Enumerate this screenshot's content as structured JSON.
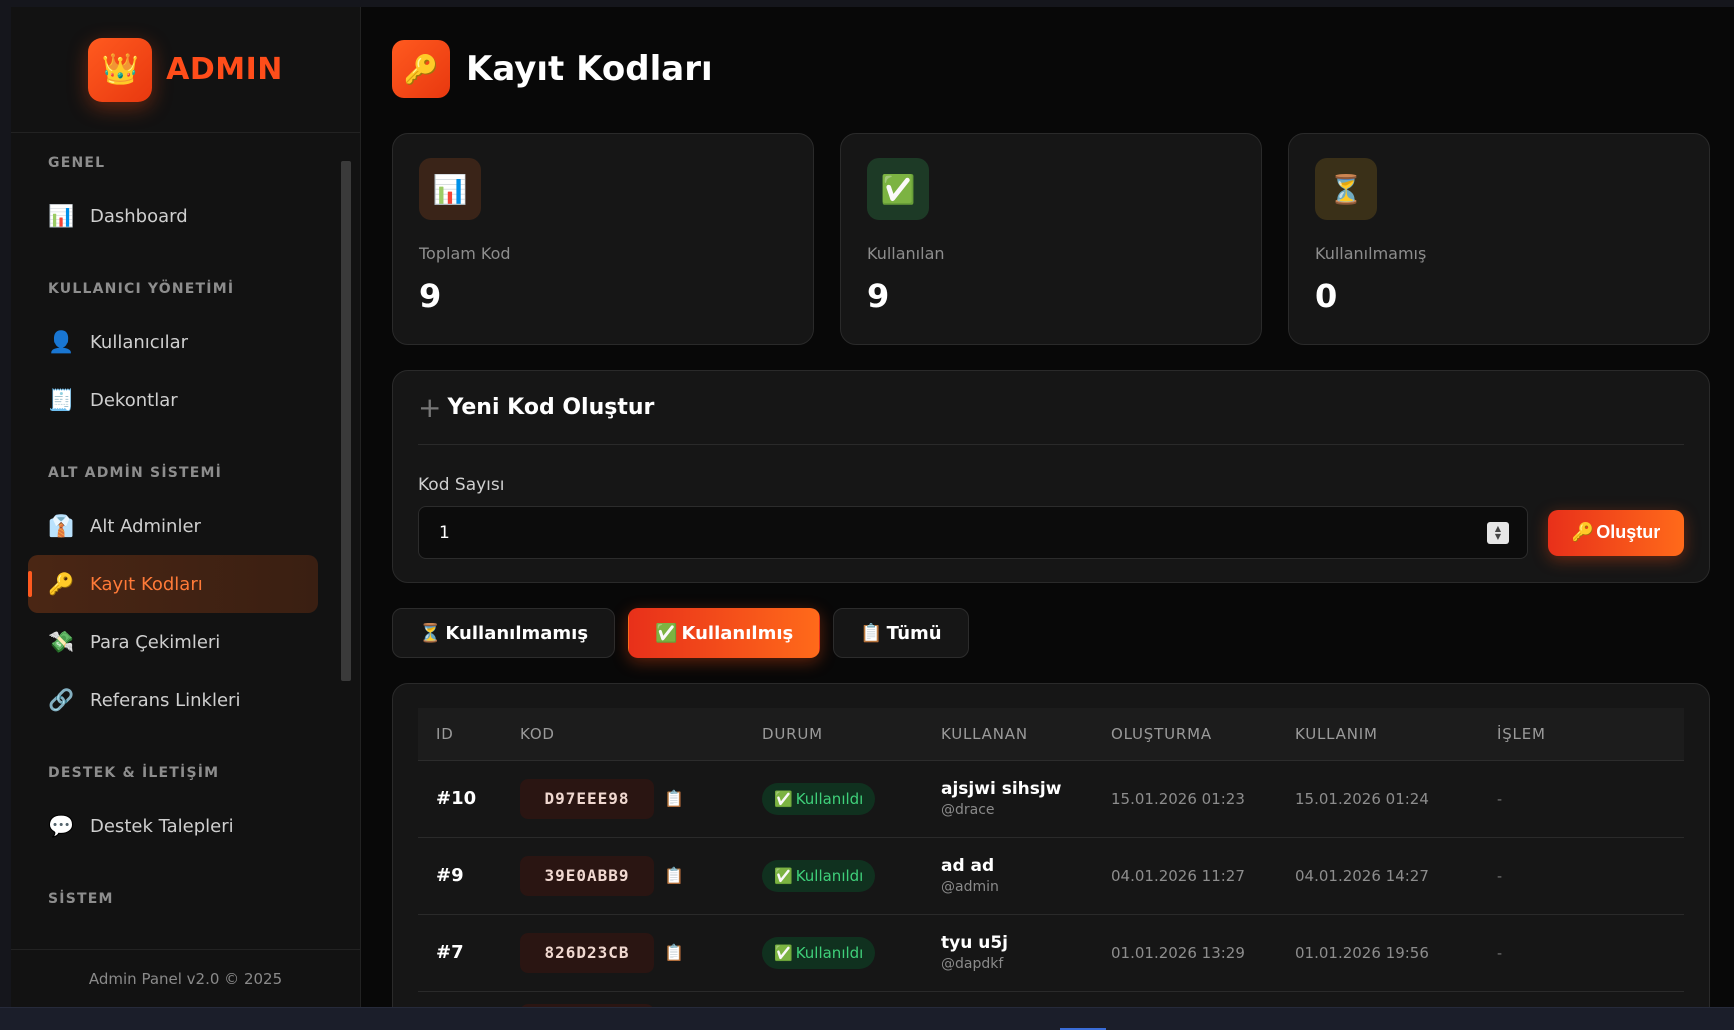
{
  "brand": {
    "icon": "crown-icon",
    "glyph": "👑",
    "name": "ADMIN"
  },
  "sidebar": {
    "sections": [
      {
        "title": "GENEL",
        "items": [
          {
            "label": "Dashboard",
            "icon": "bar-chart-icon",
            "glyph": "📊"
          }
        ]
      },
      {
        "title": "KULLANICI YÖNETİMİ",
        "items": [
          {
            "label": "Kullanıcılar",
            "icon": "user-icon",
            "glyph": "👤"
          },
          {
            "label": "Dekontlar",
            "icon": "receipt-icon",
            "glyph": "🧾"
          }
        ]
      },
      {
        "title": "ALT ADMİN SİSTEMİ",
        "items": [
          {
            "label": "Alt Adminler",
            "icon": "tie-icon",
            "glyph": "👔"
          },
          {
            "label": "Kayıt Kodları",
            "icon": "key-icon",
            "glyph": "🔑",
            "active": true
          },
          {
            "label": "Para Çekimleri",
            "icon": "money-icon",
            "glyph": "💸"
          },
          {
            "label": "Referans Linkleri",
            "icon": "link-icon",
            "glyph": "🔗"
          }
        ]
      },
      {
        "title": "DESTEK & İLETİŞİM",
        "items": [
          {
            "label": "Destek Talepleri",
            "icon": "chat-icon",
            "glyph": "💬"
          }
        ]
      },
      {
        "title": "SİSTEM",
        "items": []
      }
    ],
    "footer": "Admin Panel v2.0 © 2025"
  },
  "header": {
    "icon": "key-icon",
    "glyph": "🔑",
    "title": "Kayıt Kodları"
  },
  "stats": [
    {
      "label": "Toplam Kod",
      "value": "9",
      "icon": "bar-chart-icon",
      "glyph": "📊",
      "bg": "#3a2418"
    },
    {
      "label": "Kullanılan",
      "value": "9",
      "icon": "check-icon",
      "glyph": "✅",
      "bg": "#1d3a26"
    },
    {
      "label": "Kullanılmamış",
      "value": "0",
      "icon": "hourglass-icon",
      "glyph": "⏳",
      "bg": "#3a3018"
    }
  ],
  "create": {
    "plus": "+",
    "title": "Yeni Kod Oluştur",
    "field_label": "Kod Sayısı",
    "field_value": "1",
    "button_glyph": "🔑",
    "button_label": "Oluştur"
  },
  "tabs": [
    {
      "glyph": "⏳",
      "label": "Kullanılmamış",
      "active": false
    },
    {
      "glyph": "✅",
      "label": "Kullanılmış",
      "active": true
    },
    {
      "glyph": "📋",
      "label": "Tümü",
      "active": false
    }
  ],
  "table": {
    "columns": [
      "ID",
      "KOD",
      "DURUM",
      "KULLANAN",
      "OLUŞTURMA",
      "KULLANIM",
      "İŞLEM"
    ],
    "rows": [
      {
        "id": "#10",
        "code": "D97EEE98",
        "status": "Kullanıldı",
        "user_name": "ajsjwi sihsjw",
        "user_handle": "@drace",
        "created": "15.01.2026 01:23",
        "used": "15.01.2026 01:24",
        "action": "-"
      },
      {
        "id": "#9",
        "code": "39E0ABB9",
        "status": "Kullanıldı",
        "user_name": "ad ad",
        "user_handle": "@admin",
        "created": "04.01.2026 11:27",
        "used": "04.01.2026 14:27",
        "action": "-"
      },
      {
        "id": "#7",
        "code": "826D23CB",
        "status": "Kullanıldı",
        "user_name": "tyu u5j",
        "user_handle": "@dapdkf",
        "created": "01.01.2026 13:29",
        "used": "01.01.2026 19:56",
        "action": "-"
      }
    ],
    "status_glyph": "✅",
    "copy_glyph": "📋"
  }
}
